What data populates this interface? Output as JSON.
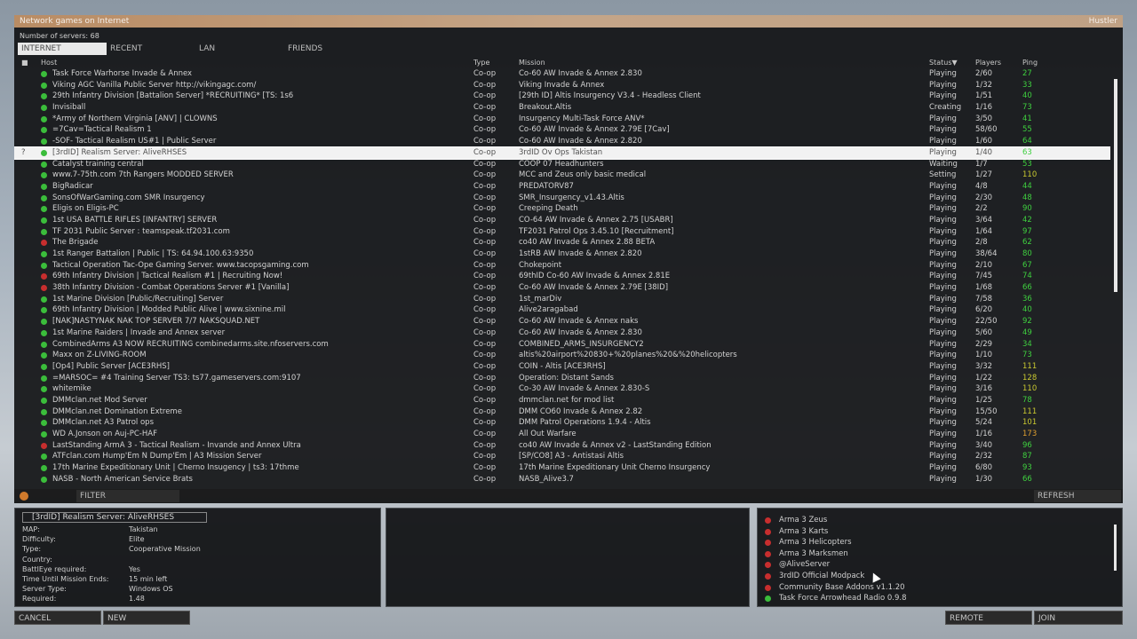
{
  "window": {
    "title": "Network games on Internet",
    "right_label": "Hustler",
    "server_count": "Number of servers: 68"
  },
  "tabs": [
    {
      "label": "INTERNET",
      "active": true
    },
    {
      "label": "RECENT",
      "active": false
    },
    {
      "label": "LAN",
      "active": false
    },
    {
      "label": "FRIENDS",
      "active": false
    }
  ],
  "columns": {
    "host": "Host",
    "type": "Type",
    "mission": "Mission",
    "status": "Status▼",
    "players": "Players",
    "ping": "Ping"
  },
  "servers": [
    {
      "host": "Task Force Warhorse Invade & Annex",
      "type": "Co-op",
      "mission": "Co-60 AW Invade & Annex 2.830",
      "status": "Playing",
      "players": "2/60",
      "ping": "27",
      "dot": "green",
      "pingc": "g"
    },
    {
      "host": "Viking AGC Vanilla Public Server http://vikingagc.com/",
      "type": "Co-op",
      "mission": "Viking Invade & Annex",
      "status": "Playing",
      "players": "1/32",
      "ping": "33",
      "dot": "green",
      "pingc": "g"
    },
    {
      "host": "29th Infantry Division [Battalion Server] *RECRUITING* [TS: 1s6",
      "type": "Co-op",
      "mission": "[29th ID] Altis Insurgency V3.4 - Headless Client",
      "status": "Playing",
      "players": "1/51",
      "ping": "40",
      "dot": "green",
      "pingc": "g"
    },
    {
      "host": "Invisiball",
      "type": "Co-op",
      "mission": "Breakout.Altis",
      "status": "Creating",
      "players": "1/16",
      "ping": "73",
      "dot": "green",
      "pingc": "g"
    },
    {
      "host": "*Army of Northern Virginia [ANV] | CLOWNS",
      "type": "Co-op",
      "mission": "Insurgency Multi-Task Force ANV*",
      "status": "Playing",
      "players": "3/50",
      "ping": "41",
      "dot": "green",
      "pingc": "g"
    },
    {
      "host": "=7Cav=Tactical Realism 1",
      "type": "Co-op",
      "mission": "Co-60 AW Invade & Annex 2.79E [7Cav]",
      "status": "Playing",
      "players": "58/60",
      "ping": "55",
      "dot": "green",
      "pingc": "g"
    },
    {
      "host": "-SOF- Tactical Realism US#1 | Public Server",
      "type": "Co-op",
      "mission": "Co-60 AW Invade & Annex 2.820",
      "status": "Playing",
      "players": "1/60",
      "ping": "64",
      "dot": "green",
      "pingc": "g"
    },
    {
      "host": "[3rdID] Realism Server: AliveRHSES",
      "type": "Co-op",
      "mission": "3rdID Ov Ops Takistan",
      "status": "Playing",
      "players": "1/40",
      "ping": "63",
      "dot": "green",
      "pingc": "g",
      "selected": true
    },
    {
      "host": "Catalyst training central",
      "type": "Co-op",
      "mission": "COOP 07 Headhunters",
      "status": "Waiting",
      "players": "1/7",
      "ping": "53",
      "dot": "green",
      "pingc": "g"
    },
    {
      "host": "www.7-75th.com 7th Rangers MODDED SERVER",
      "type": "Co-op",
      "mission": "MCC and Zeus only basic medical",
      "status": "Setting",
      "players": "1/27",
      "ping": "110",
      "dot": "green",
      "pingc": "y"
    },
    {
      "host": "BigRadicar",
      "type": "Co-op",
      "mission": "PREDATORV87",
      "status": "Playing",
      "players": "4/8",
      "ping": "44",
      "dot": "green",
      "pingc": "g"
    },
    {
      "host": "SonsOfWarGaming.com SMR Insurgency",
      "type": "Co-op",
      "mission": "SMR_Insurgency_v1.43.Altis",
      "status": "Playing",
      "players": "2/30",
      "ping": "48",
      "dot": "green",
      "pingc": "g"
    },
    {
      "host": "Eligis on Eligis-PC",
      "type": "Co-op",
      "mission": "Creeping Death",
      "status": "Playing",
      "players": "2/2",
      "ping": "90",
      "dot": "green",
      "pingc": "g"
    },
    {
      "host": "1st USA BATTLE RIFLES [INFANTRY] SERVER",
      "type": "Co-op",
      "mission": "CO-64 AW Invade & Annex 2.75 [USABR]",
      "status": "Playing",
      "players": "3/64",
      "ping": "42",
      "dot": "green",
      "pingc": "g"
    },
    {
      "host": "TF 2031 Public Server : teamspeak.tf2031.com",
      "type": "Co-op",
      "mission": "TF2031 Patrol Ops 3.45.10 [Recruitment]",
      "status": "Playing",
      "players": "1/64",
      "ping": "97",
      "dot": "green",
      "pingc": "g"
    },
    {
      "host": "The Brigade",
      "type": "Co-op",
      "mission": "co40 AW Invade & Annex 2.88 BETA",
      "status": "Playing",
      "players": "2/8",
      "ping": "62",
      "dot": "red",
      "pingc": "g"
    },
    {
      "host": "1st Ranger Battalion | Public | TS: 64.94.100.63:9350",
      "type": "Co-op",
      "mission": "1stRB AW Invade & Annex 2.820",
      "status": "Playing",
      "players": "38/64",
      "ping": "80",
      "dot": "green",
      "pingc": "g"
    },
    {
      "host": "Tactical Operation Tac-Ope Gaming Server. www.tacopsgaming.com",
      "type": "Co-op",
      "mission": "Chokepoint",
      "status": "Playing",
      "players": "2/10",
      "ping": "67",
      "dot": "green",
      "pingc": "g"
    },
    {
      "host": "69th Infantry Division | Tactical Realism #1 | Recruiting Now!",
      "type": "Co-op",
      "mission": "69thID Co-60 AW Invade & Annex 2.81E",
      "status": "Playing",
      "players": "7/45",
      "ping": "74",
      "dot": "red",
      "pingc": "g"
    },
    {
      "host": "38th Infantry Division - Combat Operations Server #1 [Vanilla]",
      "type": "Co-op",
      "mission": "Co-60 AW Invade & Annex 2.79E [38ID]",
      "status": "Playing",
      "players": "1/68",
      "ping": "66",
      "dot": "red",
      "pingc": "g"
    },
    {
      "host": "1st Marine Division [Public/Recruiting] Server",
      "type": "Co-op",
      "mission": "1st_marDiv",
      "status": "Playing",
      "players": "7/58",
      "ping": "36",
      "dot": "green",
      "pingc": "g"
    },
    {
      "host": "69th Infantry Division | Modded Public Alive | www.sixnine.mil",
      "type": "Co-op",
      "mission": "Alive2aragabad",
      "status": "Playing",
      "players": "6/20",
      "ping": "40",
      "dot": "green",
      "pingc": "g"
    },
    {
      "host": "[NAK]NASTYNAK NAK TOP SERVER 7/7 NAKSQUAD.NET",
      "type": "Co-op",
      "mission": "Co-60 AW Invade & Annex naks",
      "status": "Playing",
      "players": "22/50",
      "ping": "92",
      "dot": "green",
      "pingc": "g"
    },
    {
      "host": "1st Marine Raiders | Invade and Annex server",
      "type": "Co-op",
      "mission": "Co-60 AW Invade & Annex 2.830",
      "status": "Playing",
      "players": "5/60",
      "ping": "49",
      "dot": "green",
      "pingc": "g"
    },
    {
      "host": "CombinedArms A3 NOW RECRUITING combinedarms.site.nfoservers.com",
      "type": "Co-op",
      "mission": "COMBINED_ARMS_INSURGENCY2",
      "status": "Playing",
      "players": "2/29",
      "ping": "34",
      "dot": "green",
      "pingc": "g"
    },
    {
      "host": "Maxx on Z-LIVING-ROOM",
      "type": "Co-op",
      "mission": "altis%20airport%20830+%20planes%20&%20helicopters",
      "status": "Playing",
      "players": "1/10",
      "ping": "73",
      "dot": "green",
      "pingc": "g"
    },
    {
      "host": "[Op4] Public Server [ACE3RHS]",
      "type": "Co-op",
      "mission": "COIN - Altis [ACE3RHS]",
      "status": "Playing",
      "players": "3/32",
      "ping": "111",
      "dot": "green",
      "pingc": "y"
    },
    {
      "host": "=MARSOC= #4 Training Server TS3: ts77.gameservers.com:9107",
      "type": "Co-op",
      "mission": "Operation: Distant Sands",
      "status": "Playing",
      "players": "1/22",
      "ping": "128",
      "dot": "green",
      "pingc": "y"
    },
    {
      "host": "whitemike",
      "type": "Co-op",
      "mission": "Co-30 AW Invade & Annex 2.830-S",
      "status": "Playing",
      "players": "3/16",
      "ping": "110",
      "dot": "green",
      "pingc": "y"
    },
    {
      "host": "DMMclan.net Mod Server",
      "type": "Co-op",
      "mission": "dmmclan.net for mod list",
      "status": "Playing",
      "players": "1/25",
      "ping": "78",
      "dot": "green",
      "pingc": "g"
    },
    {
      "host": "DMMclan.net Domination Extreme",
      "type": "Co-op",
      "mission": "DMM CO60 Invade & Annex 2.82",
      "status": "Playing",
      "players": "15/50",
      "ping": "111",
      "dot": "green",
      "pingc": "y"
    },
    {
      "host": "DMMclan.net A3 Patrol ops",
      "type": "Co-op",
      "mission": "DMM Patrol Operations 1.9.4 - Altis",
      "status": "Playing",
      "players": "5/24",
      "ping": "101",
      "dot": "green",
      "pingc": "y"
    },
    {
      "host": "WD A.Jonson on Auj-PC-HAF",
      "type": "Co-op",
      "mission": "All Out Warfare",
      "status": "Playing",
      "players": "1/16",
      "ping": "173",
      "dot": "green",
      "pingc": "o"
    },
    {
      "host": "LastStanding ArmA 3 - Tactical Realism - Invande and Annex Ultra",
      "type": "Co-op",
      "mission": "co40 AW Invade & Annex v2 - LastStanding Edition",
      "status": "Playing",
      "players": "3/40",
      "ping": "96",
      "dot": "red",
      "pingc": "g"
    },
    {
      "host": "ATFclan.com Hump'Em N Dump'Em | A3 Mission Server",
      "type": "Co-op",
      "mission": "[SP/CO8] A3 - Antistasi Altis",
      "status": "Playing",
      "players": "2/32",
      "ping": "87",
      "dot": "green",
      "pingc": "g"
    },
    {
      "host": "17th Marine Expeditionary Unit | Cherno Insugency | ts3: 17thme",
      "type": "Co-op",
      "mission": "17th Marine Expeditionary Unit Cherno Insurgency",
      "status": "Playing",
      "players": "6/80",
      "ping": "93",
      "dot": "green",
      "pingc": "g"
    },
    {
      "host": "NASB - North American Service Brats",
      "type": "Co-op",
      "mission": "NASB_Alive3.7",
      "status": "Playing",
      "players": "1/30",
      "ping": "66",
      "dot": "green",
      "pingc": "g"
    }
  ],
  "midbar": {
    "filter": "FILTER",
    "refresh": "REFRESH"
  },
  "details": {
    "name": "[3rdID] Realism Server: AliveRHSES",
    "fields": [
      {
        "k": "MAP:",
        "v": "Takistan"
      },
      {
        "k": "Difficulty:",
        "v": "Elite"
      },
      {
        "k": "Type:",
        "v": "Cooperative Mission"
      },
      {
        "k": "Country:",
        "v": ""
      },
      {
        "k": "BattlEye required:",
        "v": "Yes"
      },
      {
        "k": "Time Until Mission Ends:",
        "v": "15 min left"
      },
      {
        "k": "Server Type:",
        "v": "Windows OS"
      },
      {
        "k": "Required:",
        "v": "1.48"
      }
    ]
  },
  "mods": [
    {
      "name": "Arma 3 Zeus",
      "color": "red"
    },
    {
      "name": "Arma 3 Karts",
      "color": "red"
    },
    {
      "name": "Arma 3 Helicopters",
      "color": "red"
    },
    {
      "name": "Arma 3 Marksmen",
      "color": "red"
    },
    {
      "name": "@AliveServer",
      "color": "red"
    },
    {
      "name": "3rdID Official Modpack",
      "color": "red"
    },
    {
      "name": "Community Base Addons v1.1.20",
      "color": "red"
    },
    {
      "name": "Task Force Arrowhead Radio 0.9.8",
      "color": "green"
    }
  ],
  "bottom": {
    "cancel": "CANCEL",
    "new": "NEW",
    "remote": "REMOTE",
    "join": "JOIN"
  },
  "colors": {
    "title_bar": "#b98c64",
    "selected_row": "#f2f2f2",
    "dot_green": "#3bbd3b",
    "dot_red": "#c72e2e"
  }
}
